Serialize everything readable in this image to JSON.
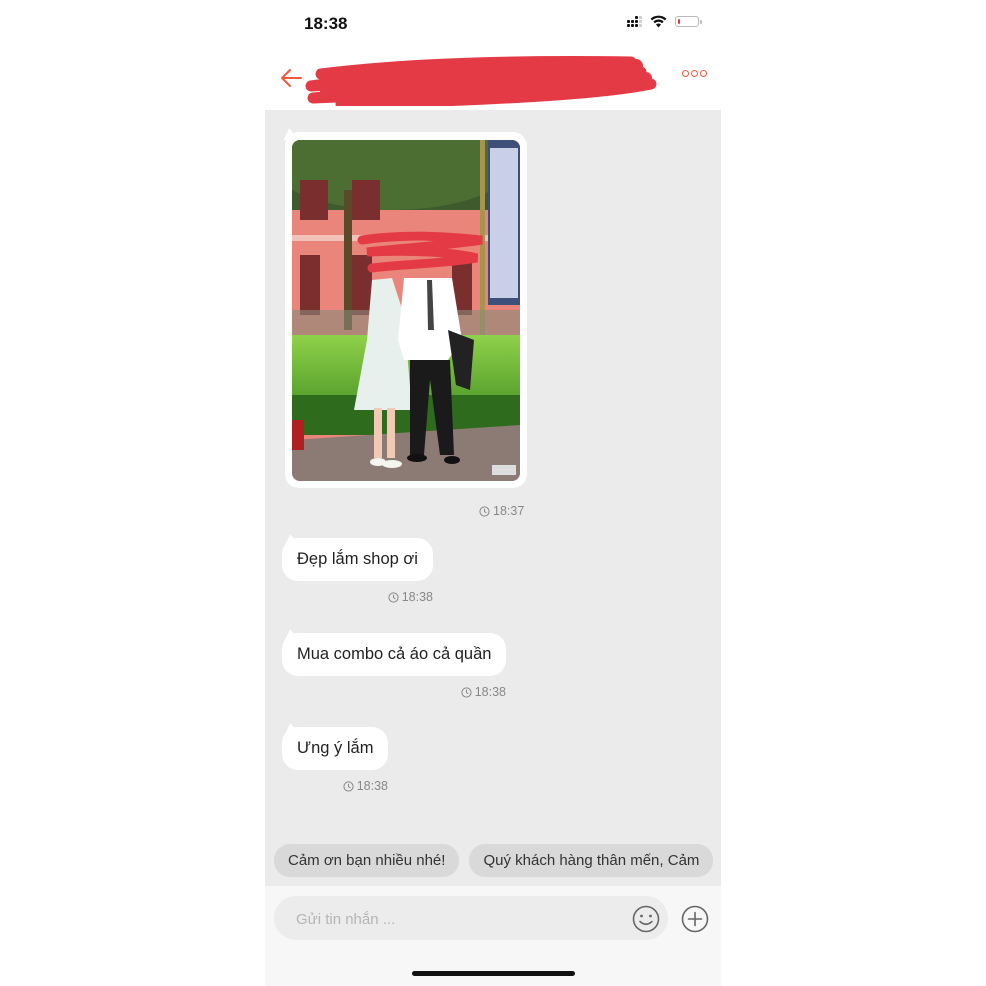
{
  "status_bar": {
    "time": "18:38",
    "battery_level_percent": 10
  },
  "header": {
    "back_icon": "arrow-left-icon",
    "contact_name": "[redacted]",
    "more_icon": "more-horizontal-icon",
    "accent_color": "#ee5a3c"
  },
  "messages": [
    {
      "type": "image",
      "description": "Couple photo in front of pink building (faces redacted)",
      "time": "18:37"
    },
    {
      "type": "text",
      "text": "Đẹp lắm shop ơi",
      "time": "18:38"
    },
    {
      "type": "text",
      "text": "Mua combo cả áo cả quần",
      "time": "18:38"
    },
    {
      "type": "text",
      "text": "Ưng ý lắm",
      "time": "18:38"
    }
  ],
  "quick_replies": [
    "Cảm ơn bạn nhiều nhé!",
    "Quý khách hàng thân mến, Cảm"
  ],
  "composer": {
    "placeholder": "Gửi tin nhắn ...",
    "value": "",
    "emoji_icon": "smiley-icon",
    "attach_icon": "plus-circle-icon"
  }
}
